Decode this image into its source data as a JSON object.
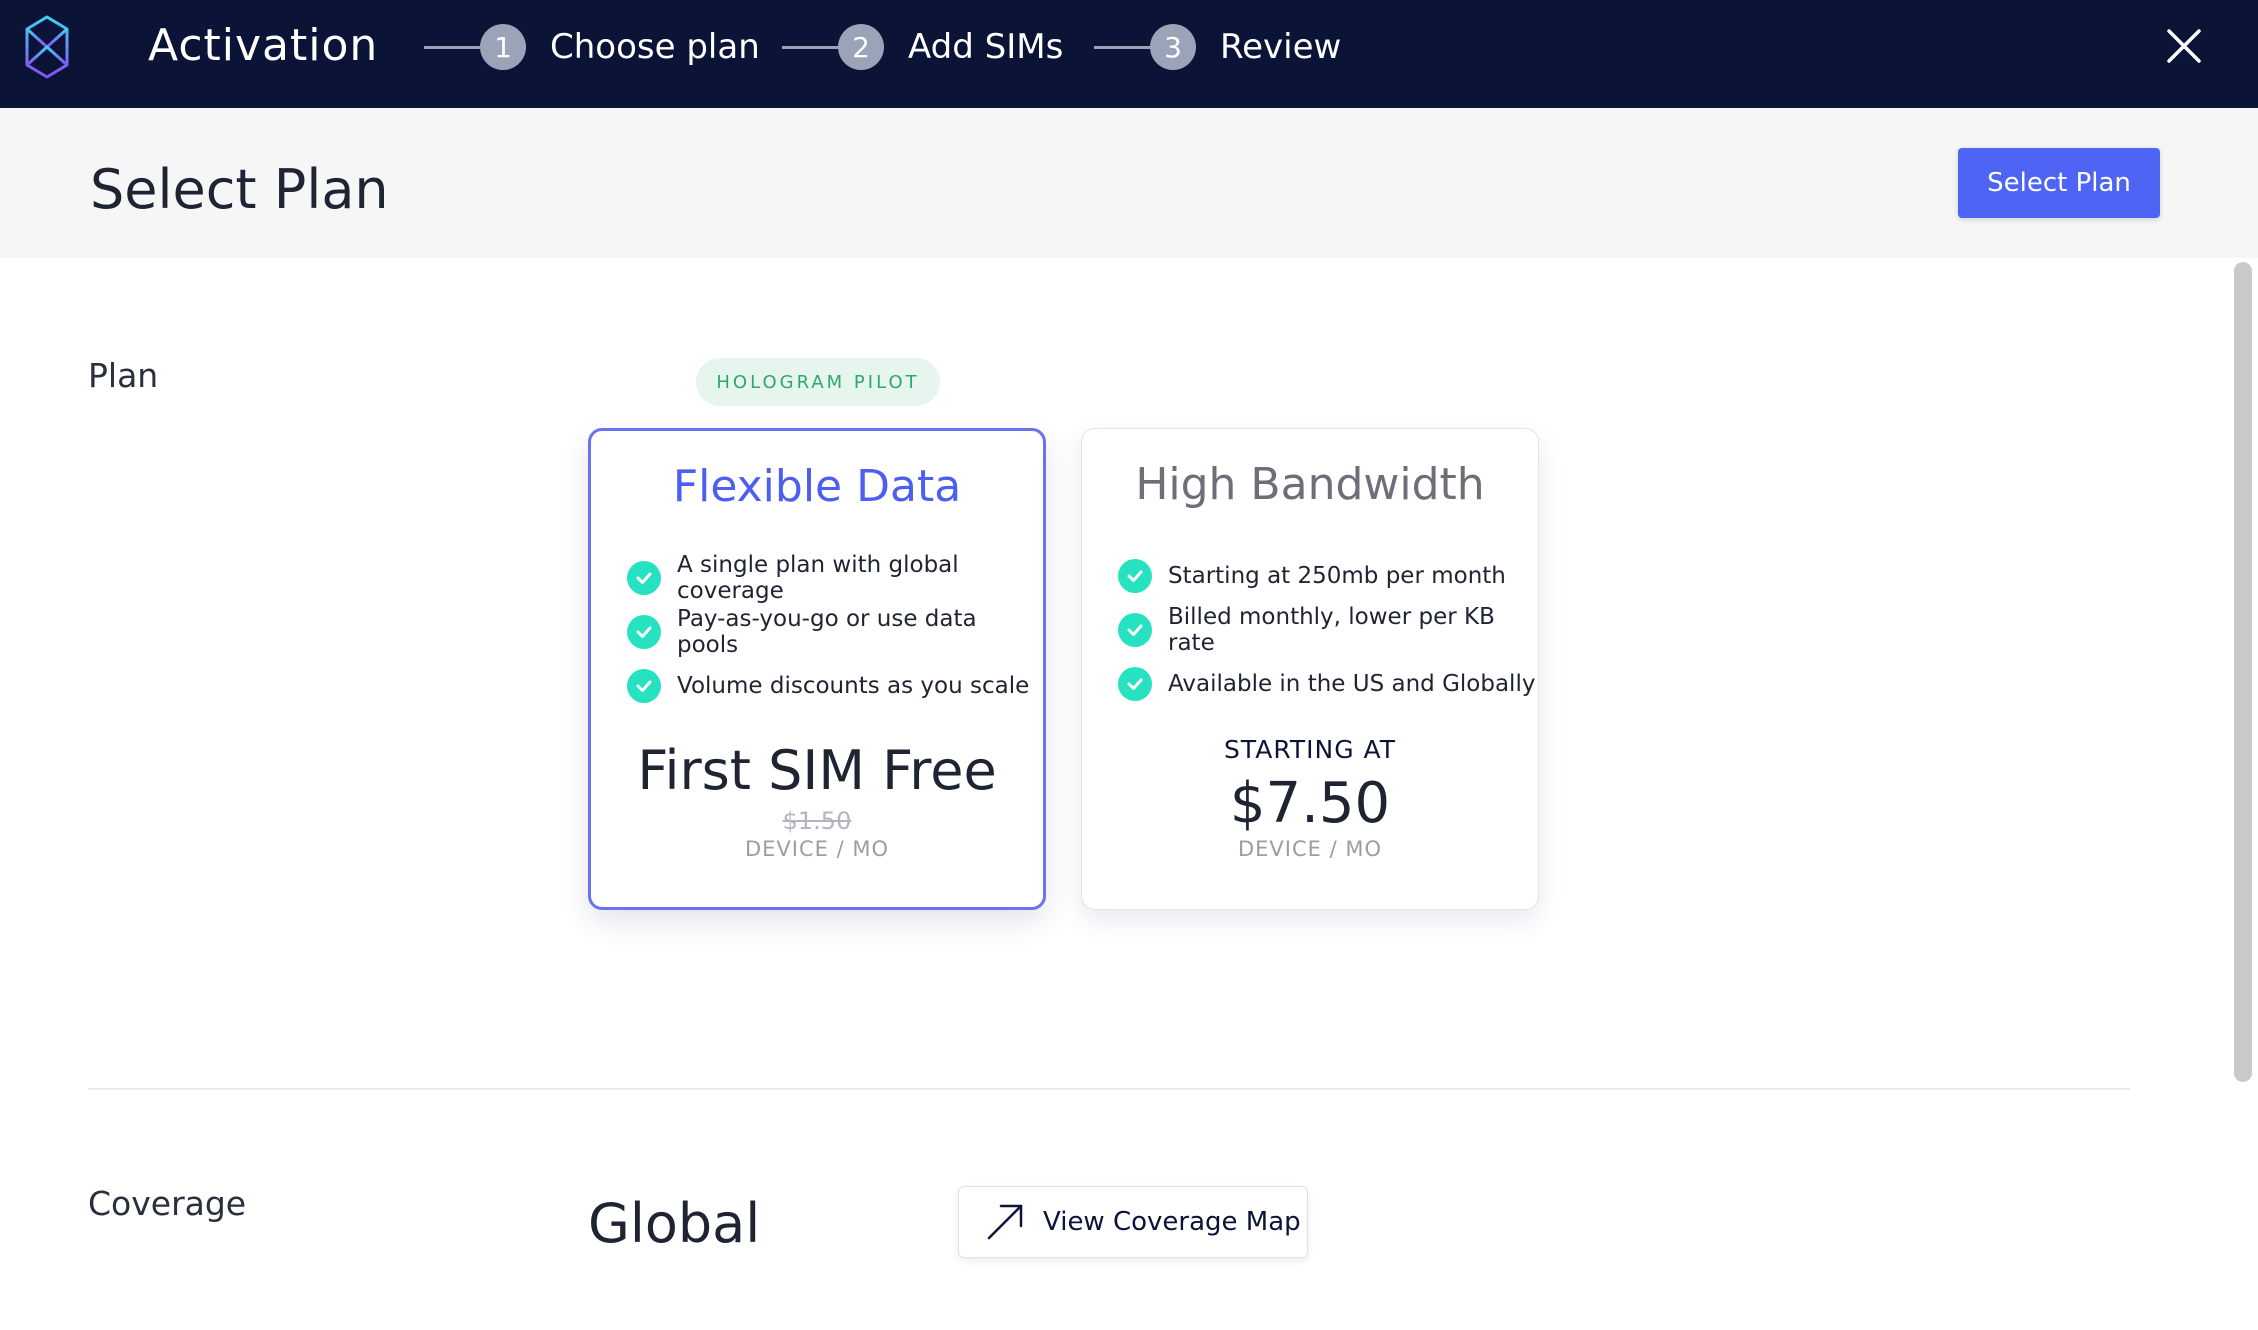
{
  "header": {
    "app_title": "Activation",
    "steps": [
      {
        "number": "1",
        "label": "Choose plan"
      },
      {
        "number": "2",
        "label": "Add SIMs"
      },
      {
        "number": "3",
        "label": "Review"
      }
    ]
  },
  "subheader": {
    "title": "Select Plan",
    "primary_button": "Select Plan"
  },
  "plan_section": {
    "label": "Plan",
    "badge": "HOLOGRAM PILOT",
    "cards": [
      {
        "title": "Flexible Data",
        "selected": true,
        "features": [
          "A single plan with global coverage",
          "Pay-as-you-go or use data pools",
          "Volume discounts as you scale"
        ],
        "price_main": "First SIM Free",
        "price_strike": "$1.50",
        "price_unit": "DEVICE / MO"
      },
      {
        "title": "High Bandwidth",
        "selected": false,
        "features": [
          "Starting at 250mb per month",
          "Billed monthly, lower per KB rate",
          "Available in the US and Globally"
        ],
        "price_prefix": "STARTING AT",
        "price_main": "$7.50",
        "price_unit": "DEVICE / MO"
      }
    ]
  },
  "coverage_section": {
    "label": "Coverage",
    "value": "Global",
    "map_button": "View Coverage Map"
  },
  "colors": {
    "nav_bg": "#0b1437",
    "accent": "#4d64f5",
    "check": "#27e2c0",
    "badge_text": "#2fa86a"
  },
  "icons": {
    "logo": "hologram-logo-icon",
    "close": "close-icon",
    "check": "check-circle-icon",
    "external": "arrow-up-right-icon"
  }
}
